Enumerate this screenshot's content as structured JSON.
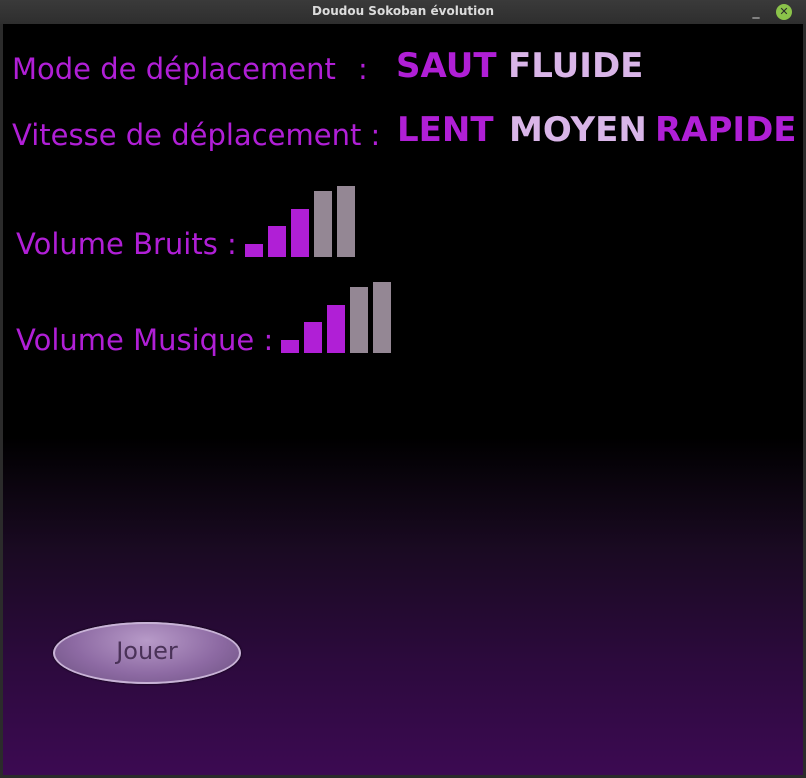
{
  "window": {
    "title": "Doudou Sokoban évolution",
    "minimize_glyph": "_",
    "close_glyph": "✕"
  },
  "menu": {
    "movement_mode": {
      "label": "Mode de déplacement",
      "colon": ":",
      "options": [
        "SAUT",
        "FLUIDE"
      ],
      "selected": "SAUT"
    },
    "movement_speed": {
      "label": "Vitesse de déplacement :",
      "options": [
        "LENT",
        "MOYEN",
        "RAPIDE"
      ],
      "selected": [
        "LENT",
        "RAPIDE"
      ]
    },
    "sound_volume": {
      "label": "Volume Bruits :",
      "level": 3,
      "max": 5
    },
    "music_volume": {
      "label": "Volume Musique :",
      "level": 3,
      "max": 5
    }
  },
  "play_button": {
    "label": "Jouer"
  },
  "colors": {
    "accent": "#b01fd6",
    "inactive": "#d9b5e8",
    "bar_active": "#b01fd6",
    "bar_inactive": "#948794",
    "button": "#8d6aa3"
  }
}
